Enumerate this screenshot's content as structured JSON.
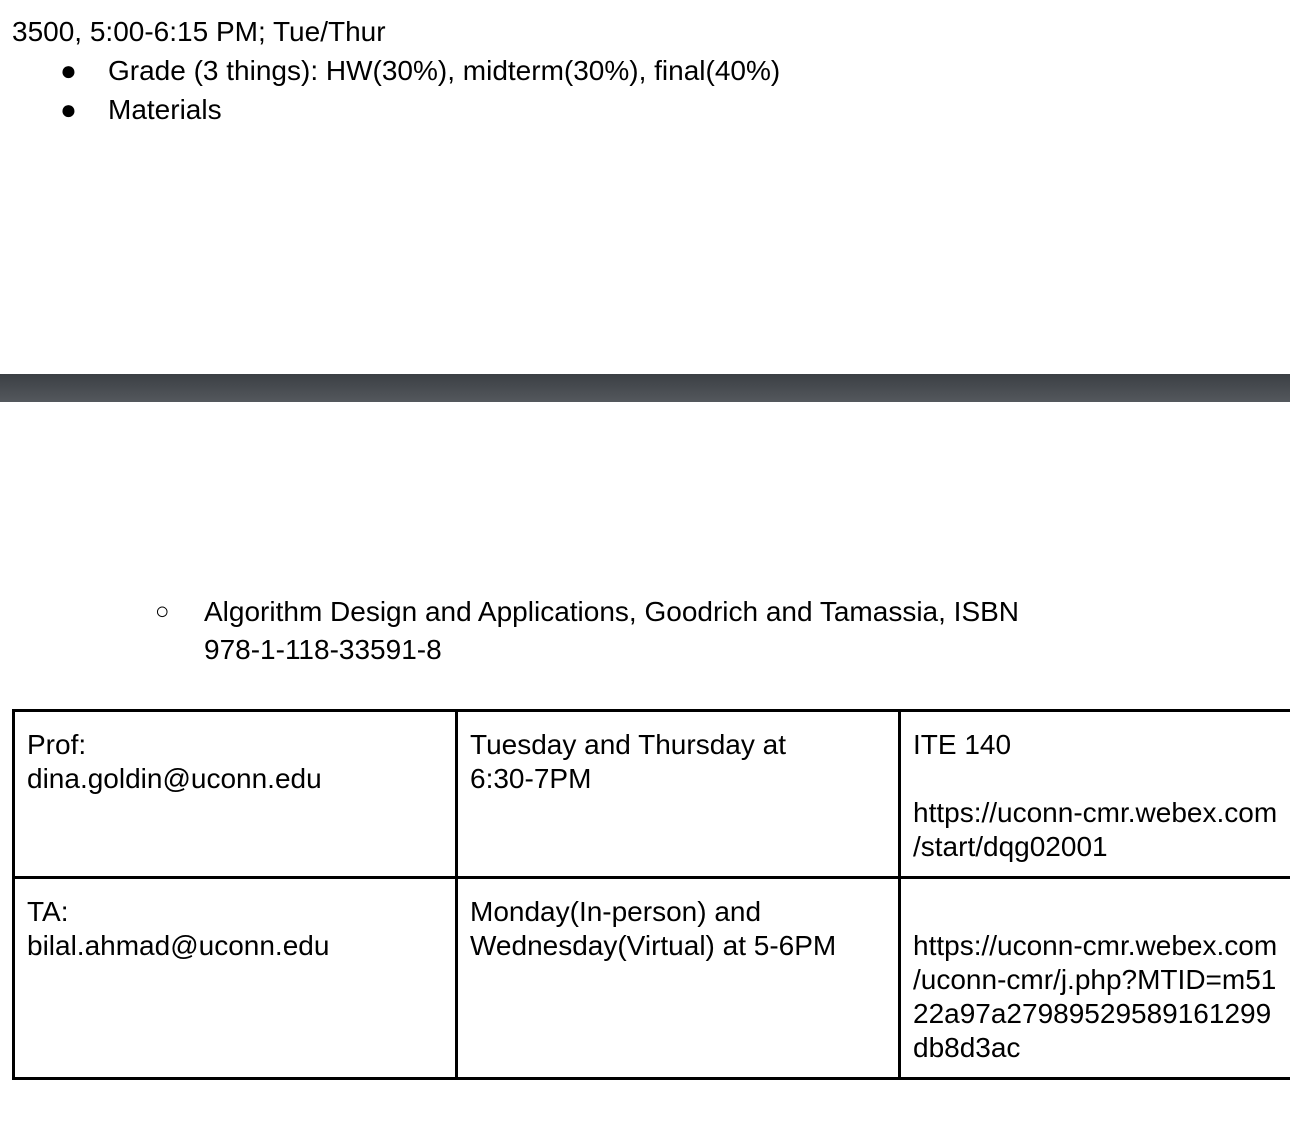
{
  "doc": {
    "schedule_line": "3500, 5:00-6:15 PM; Tue/Thur",
    "bullets": [
      "Grade (3 things): HW(30%), midterm(30%), final(40%)",
      "Materials"
    ],
    "sub_bullet": {
      "line1": "Algorithm Design and Applications, Goodrich and Tamassia, ISBN",
      "line2": "978-1-118-33591-8"
    },
    "table": {
      "rows": [
        {
          "role": "Prof:",
          "email": "dina.goldin@uconn.edu",
          "hours_line1": "Tuesday and Thursday at",
          "hours_line2": "6:30-7PM",
          "location": "ITE 140",
          "link_lines": [
            "https://uconn-cmr.webex.com",
            "/start/dqg02001"
          ]
        },
        {
          "role": "TA:",
          "email": "bilal.ahmad@uconn.edu",
          "hours_line1": "Monday(In-person) and",
          "hours_line2": "Wednesday(Virtual) at 5-6PM",
          "link_lines": [
            "https://uconn-cmr.webex.com",
            "/uconn-cmr/j.php?MTID=m51",
            "22a97a27989529589161299",
            "db8d3ac"
          ]
        }
      ]
    }
  }
}
